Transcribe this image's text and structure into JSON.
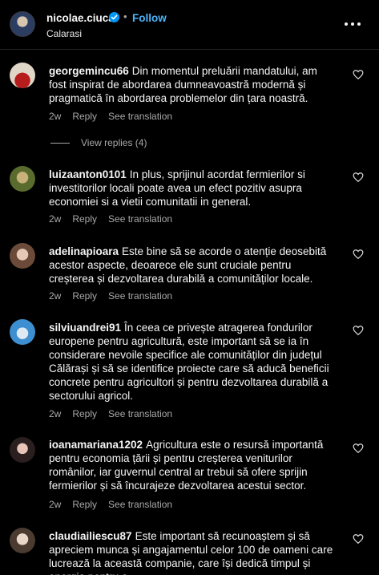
{
  "header": {
    "username": "nicolae.ciuca",
    "separator": "•",
    "follow_label": "Follow",
    "location": "Calarasi"
  },
  "comments": [
    {
      "username": "georgemincu66",
      "text": "Din momentul preluării mandatului, am fost inspirat de abordarea dumneavoastră modernă și pragmatică în abordarea problemelor din țara noastră.",
      "age": "2w",
      "reply_label": "Reply",
      "translate_label": "See translation"
    },
    {
      "username": "luizaanton0101",
      "text": "In plus, sprijinul acordat fermierilor si investitorilor locali poate avea un efect pozitiv asupra economiei si a vietii comunitatii in general.",
      "age": "2w",
      "reply_label": "Reply",
      "translate_label": "See translation"
    },
    {
      "username": "adelinapioara",
      "text": "Este bine să se acorde o atenție deosebită acestor aspecte, deoarece ele sunt cruciale pentru creșterea și dezvoltarea durabilă a comunităților locale.",
      "age": "2w",
      "reply_label": "Reply",
      "translate_label": "See translation"
    },
    {
      "username": "silviuandrei91",
      "text": "În ceea ce privește atragerea fondurilor europene pentru agricultură, este important să se ia în considerare nevoile specifice ale comunităților din județul Călărași și să se identifice proiecte care să aducă beneficii concrete pentru agricultori și pentru dezvoltarea durabilă a sectorului agricol.",
      "age": "2w",
      "reply_label": "Reply",
      "translate_label": "See translation"
    },
    {
      "username": "ioanamariana1202",
      "text": "Agricultura este o resursă importantă pentru economia țării și pentru creșterea veniturilor românilor, iar guvernul central ar trebui să ofere sprijin fermierilor și să încurajeze dezvoltarea acestui sector.",
      "age": "2w",
      "reply_label": "Reply",
      "translate_label": "See translation"
    },
    {
      "username": "claudiailiescu87",
      "text": "Este important să recunoaștem și să apreciem munca și angajamentul celor 100 de oameni care lucrează la această companie, care își dedică timpul și energia pentru a",
      "age": "",
      "reply_label": "",
      "translate_label": ""
    }
  ],
  "view_replies": "View replies (4)",
  "icons": {
    "verified": "verified-badge-icon",
    "more": "more-options-icon",
    "like": "heart-icon"
  },
  "colors": {
    "background": "#000000",
    "text": "#f5f5f5",
    "muted": "#a8a8a8",
    "link": "#4cb5f9",
    "verified": "#0095f6"
  }
}
